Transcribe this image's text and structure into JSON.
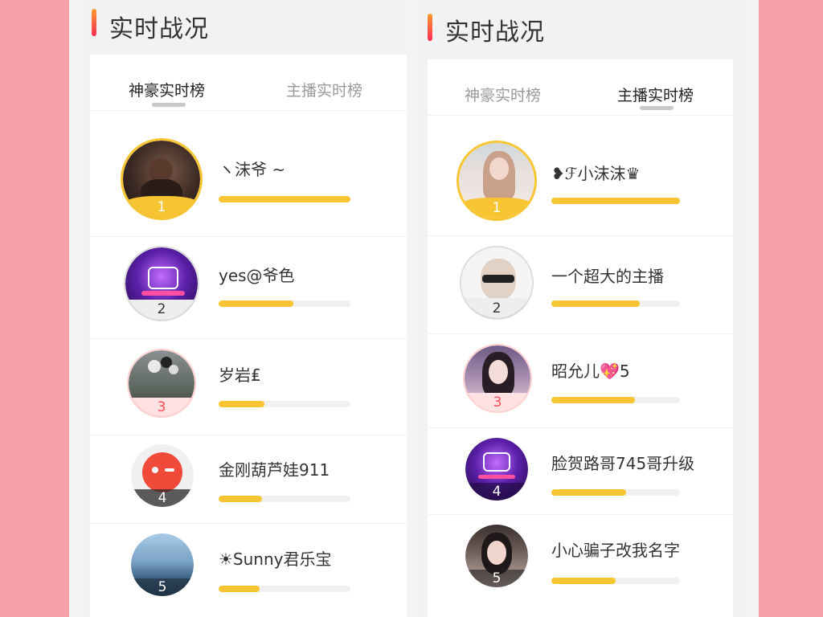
{
  "colors": {
    "page_background": "#f9a1ab",
    "accent_gradient_top": "#ff9a2e",
    "accent_gradient_bottom": "#ff2d55",
    "progress_fill": "#f7c531",
    "progress_track": "#f0f0f0",
    "rank1_color": "#f7c531",
    "rank2_color": "#dcdcdc",
    "rank3_color": "#ffd6d6"
  },
  "left_panel": {
    "title": "实时战况",
    "tabs": [
      {
        "label": "神豪实时榜",
        "active": true
      },
      {
        "label": "主播实时榜",
        "active": false
      }
    ],
    "rows": [
      {
        "rank": "1",
        "name": "ヽ沫爷 ~",
        "progress": 1.0,
        "avatar_icon": "person-sitting-photo-icon"
      },
      {
        "rank": "2",
        "name": "yes@爷色",
        "progress": 0.57,
        "avatar_icon": "neon-emblem-icon"
      },
      {
        "rank": "3",
        "name": "岁岩₤",
        "progress": 0.35,
        "avatar_icon": "balloons-photo-icon"
      },
      {
        "rank": "4",
        "name": "金刚葫芦娃911",
        "progress": 0.33,
        "avatar_icon": "red-mascot-icon"
      },
      {
        "rank": "5",
        "name": "☀Sunny君乐宝",
        "progress": 0.31,
        "avatar_icon": "sky-landscape-icon"
      }
    ]
  },
  "right_panel": {
    "title": "实时战况",
    "tabs": [
      {
        "label": "神豪实时榜",
        "active": false
      },
      {
        "label": "主播实时榜",
        "active": true
      }
    ],
    "rows": [
      {
        "rank": "1",
        "name": "❥ℱ小沫沫♛",
        "progress": 1.0,
        "avatar_icon": "girl-portrait-icon"
      },
      {
        "rank": "2",
        "name": "一个超大的主播",
        "progress": 0.69,
        "avatar_icon": "sunglasses-man-icon"
      },
      {
        "rank": "3",
        "name": "昭允儿💖5",
        "progress": 0.65,
        "avatar_icon": "woman-portrait-icon"
      },
      {
        "rank": "4",
        "name": "脸贺路哥745哥升级",
        "progress": 0.58,
        "avatar_icon": "neon-emblem-icon"
      },
      {
        "rank": "5",
        "name": "小心骗子改我名字",
        "progress": 0.5,
        "avatar_icon": "selfie-portrait-icon"
      }
    ]
  }
}
